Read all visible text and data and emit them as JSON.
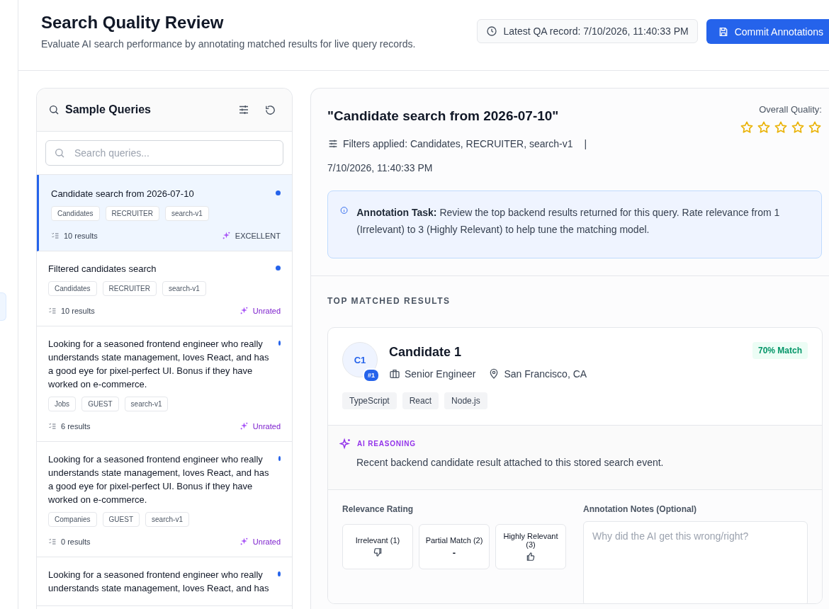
{
  "header": {
    "title": "Search Quality Review",
    "subtitle": "Evaluate AI search performance by annotating matched results for live query records.",
    "latest_record": "Latest QA record: 7/10/2026, 11:40:33 PM",
    "commit_button": "Commit Annotations"
  },
  "queries_panel": {
    "title": "Sample Queries",
    "search": {
      "placeholder": "Search queries..."
    },
    "items": [
      {
        "text": "Candidate search from 2026-07-10",
        "selected": true,
        "tags": [
          "Candidates",
          "RECRUITER",
          "search-v1"
        ],
        "results": "10 results",
        "rating": "EXCELLENT",
        "rated": true
      },
      {
        "text": "Filtered candidates search",
        "selected": false,
        "tags": [
          "Candidates",
          "RECRUITER",
          "search-v1"
        ],
        "results": "10 results",
        "rating": "Unrated",
        "rated": false
      },
      {
        "text": "Looking for a seasoned frontend engineer who really understands state management, loves React, and has a good eye for pixel-perfect UI. Bonus if they have worked on e-commerce.",
        "selected": false,
        "tags": [
          "Jobs",
          "GUEST",
          "search-v1"
        ],
        "results": "6 results",
        "rating": "Unrated",
        "rated": false
      },
      {
        "text": "Looking for a seasoned frontend engineer who really understands state management, loves React, and has a good eye for pixel-perfect UI. Bonus if they have worked on e-commerce.",
        "selected": false,
        "tags": [
          "Companies",
          "GUEST",
          "search-v1"
        ],
        "results": "0 results",
        "rating": "Unrated",
        "rated": false
      },
      {
        "text": "Looking for a seasoned frontend engineer who really understands state management, loves React, and has",
        "selected": false
      }
    ]
  },
  "detail": {
    "title": "\"Candidate search from 2026-07-10\"",
    "filters": "Filters applied: Candidates, RECRUITER, search-v1",
    "separator": "|",
    "timestamp": "7/10/2026, 11:40:33 PM",
    "quality_label": "Overall Quality:",
    "stars": 0,
    "task": "**Annotation Task:** Review the top backend results returned for this query. Rate relevance from 1 (Irrelevant) to 3 (Highly Relevant) to help tune the matching model.",
    "results_heading": "TOP MATCHED RESULTS",
    "result": {
      "initials": "C1",
      "rank": "#1",
      "name": "Candidate 1",
      "match": "70% Match",
      "role": "Senior Engineer",
      "location": "San Francisco, CA",
      "skills": [
        "TypeScript",
        "React",
        "Node.js"
      ],
      "reasoning_label": "AI REASONING",
      "reasoning": "Recent backend candidate result attached to this stored search event.",
      "rating_label": "Relevance Rating",
      "ratings": [
        {
          "label": "Irrelevant (1)",
          "kind": "down",
          "selected": false
        },
        {
          "label": "Partial Match (2)",
          "kind": "dash",
          "symbol": "-",
          "selected": false
        },
        {
          "label": "Highly Relevant (3)",
          "kind": "up",
          "selected": false
        }
      ],
      "notes_label": "Annotation Notes (Optional)",
      "notes": {
        "placeholder": "Why did the AI get this wrong/right?"
      }
    }
  }
}
